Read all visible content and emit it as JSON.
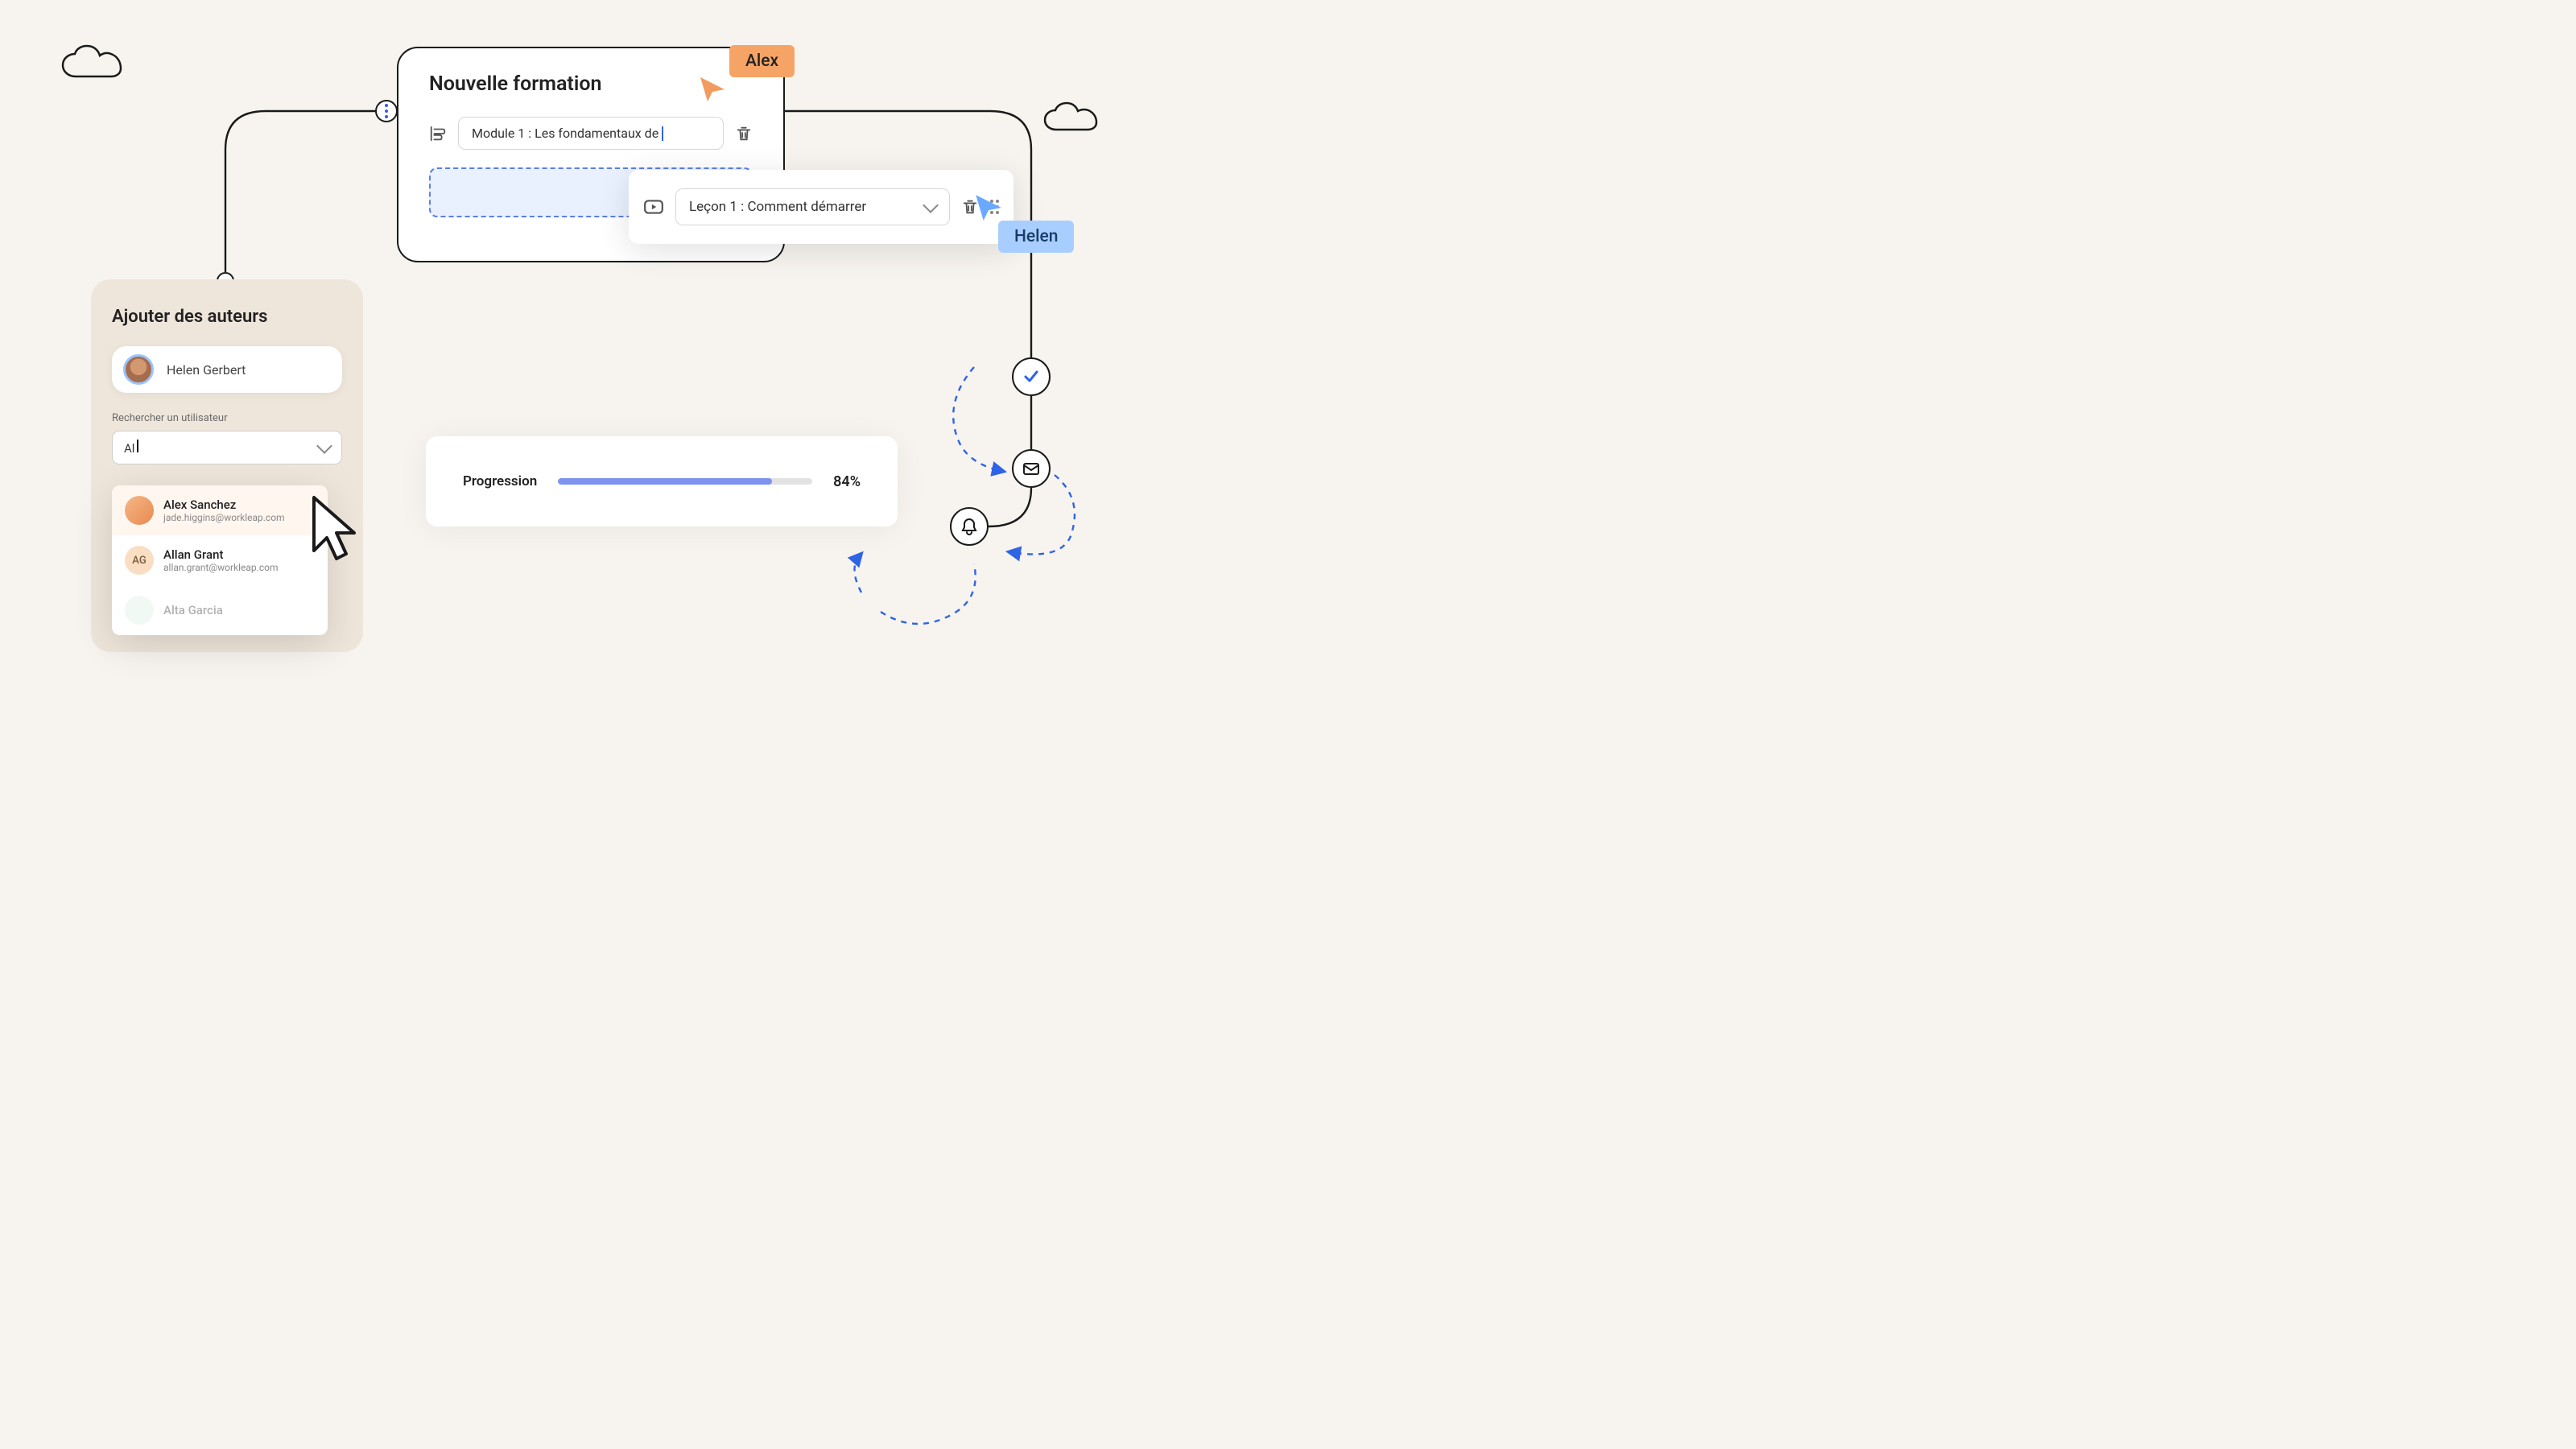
{
  "formation": {
    "title": "Nouvelle formation",
    "module_input_label": "Module 1 : Les fondamentaux de",
    "lesson_input_label": "Leçon 1 : Comment démarrer"
  },
  "cursors": {
    "alex": "Alex",
    "helen": "Helen"
  },
  "authors": {
    "title": "Ajouter des auteurs",
    "chip_name": "Helen Gerbert",
    "search_label": "Rechercher un utilisateur",
    "search_value": "Al",
    "results": [
      {
        "name": "Alex Sanchez",
        "email": "jade.higgins@workleap.com",
        "initials": ""
      },
      {
        "name": "Allan Grant",
        "email": "allan.grant@workleap.com",
        "initials": "AG"
      },
      {
        "name": "Alta Garcia",
        "email": "",
        "initials": ""
      }
    ]
  },
  "progress": {
    "label": "Progression",
    "percent": 84,
    "display": "84%"
  },
  "colors": {
    "accent_blue": "#2e64e6",
    "accent_orange": "#f6a465",
    "accent_lightblue": "#a8ceff",
    "progress_fill": "#7e93f0"
  }
}
